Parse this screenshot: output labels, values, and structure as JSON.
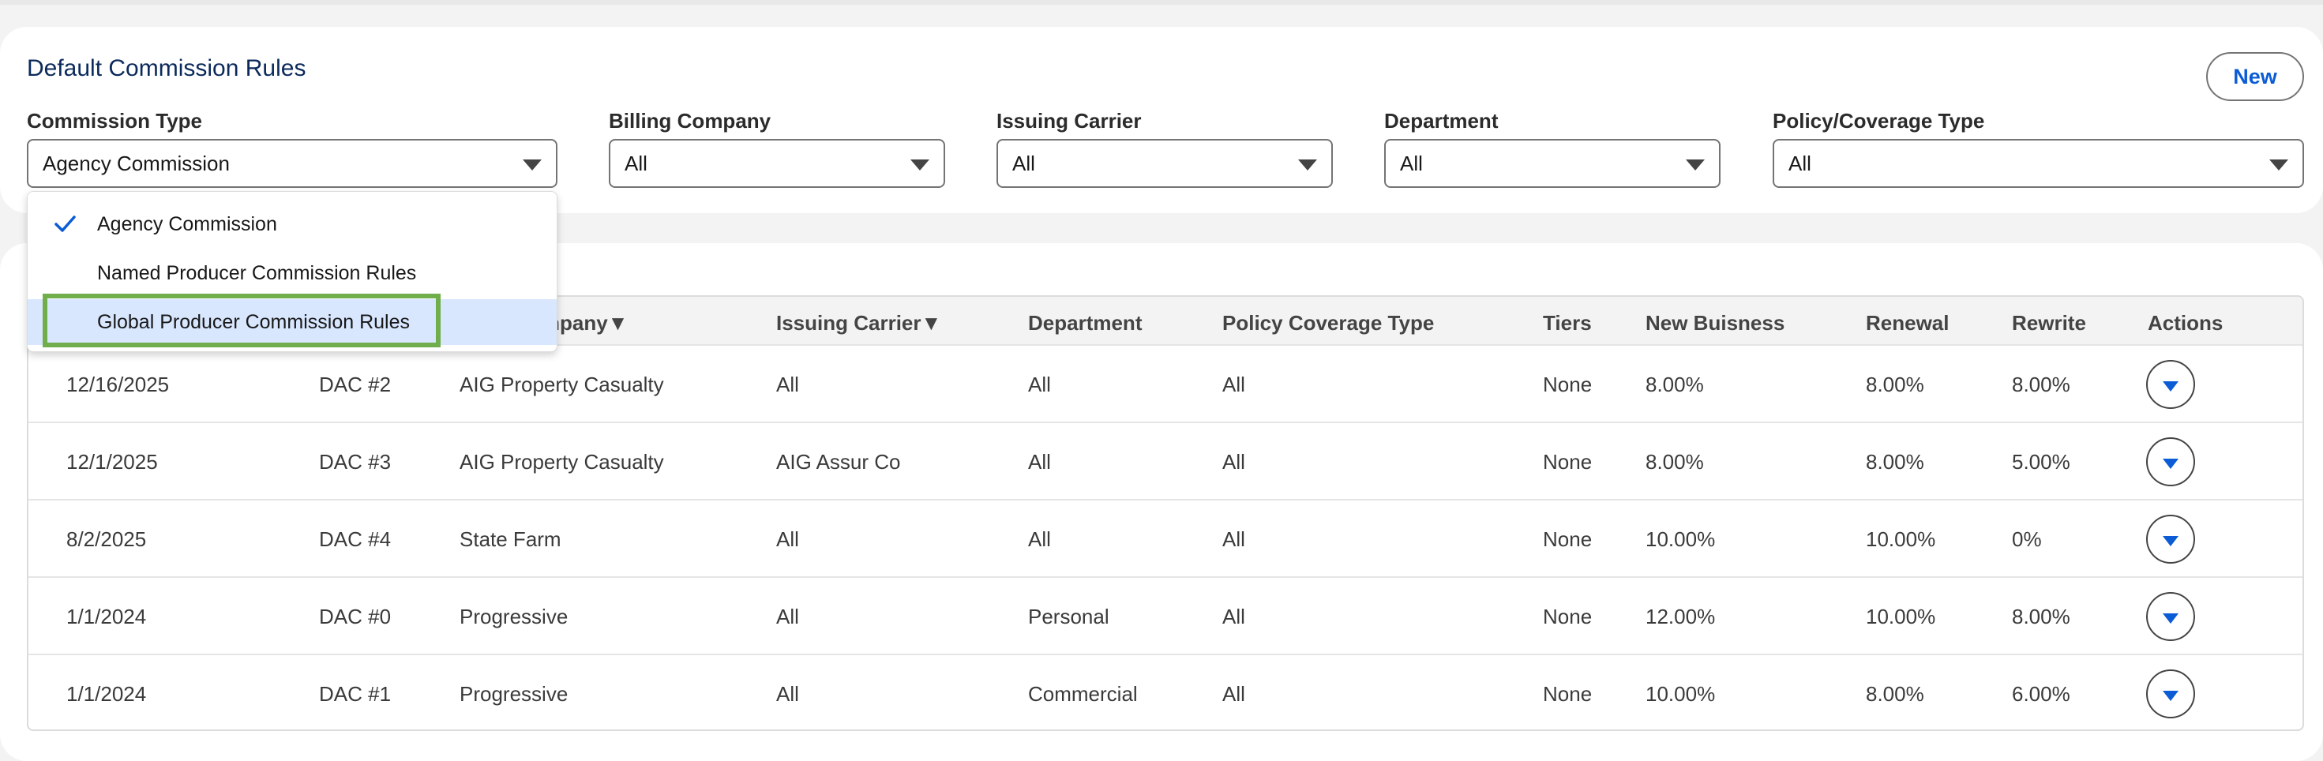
{
  "header": {
    "title": "Default Commission Rules",
    "new_label": "New"
  },
  "filters": {
    "commission_type": {
      "label": "Commission Type",
      "value": "Agency Commission"
    },
    "billing_company": {
      "label": "Billing Company",
      "value": "All"
    },
    "issuing_carrier": {
      "label": "Issuing Carrier",
      "value": "All"
    },
    "department": {
      "label": "Department",
      "value": "All"
    },
    "policy_coverage_type": {
      "label": "Policy/Coverage Type",
      "value": "All"
    }
  },
  "dropdown": {
    "options": [
      {
        "label": "Agency Commission",
        "selected": true
      },
      {
        "label": "Named Producer Commission Rules",
        "selected": false
      },
      {
        "label": "Global Producer Commission Rules",
        "selected": false,
        "highlighted": true
      }
    ]
  },
  "table": {
    "columns": {
      "billing_company": "ompany▼",
      "issuing_carrier": "Issuing Carrier▼",
      "department": "Department",
      "policy_coverage_type": "Policy Coverage Type",
      "tiers": "Tiers",
      "new_business": "New Buisness",
      "renewal": "Renewal",
      "rewrite": "Rewrite",
      "actions": "Actions"
    },
    "rows": [
      {
        "date": "12/16/2025",
        "name": "DAC #2",
        "billing_company": "AIG Property Casualty",
        "issuing_carrier": "All",
        "department": "All",
        "policy_coverage_type": "All",
        "tiers": "None",
        "new_business": "8.00%",
        "renewal": "8.00%",
        "rewrite": "8.00%"
      },
      {
        "date": "12/1/2025",
        "name": "DAC #3",
        "billing_company": "AIG Property Casualty",
        "issuing_carrier": "AIG Assur Co",
        "department": "All",
        "policy_coverage_type": "All",
        "tiers": "None",
        "new_business": "8.00%",
        "renewal": "8.00%",
        "rewrite": "5.00%"
      },
      {
        "date": "8/2/2025",
        "name": "DAC #4",
        "billing_company": "State Farm",
        "issuing_carrier": "All",
        "department": "All",
        "policy_coverage_type": "All",
        "tiers": "None",
        "new_business": "10.00%",
        "renewal": "10.00%",
        "rewrite": "0%"
      },
      {
        "date": "1/1/2024",
        "name": "DAC #0",
        "billing_company": "Progressive",
        "issuing_carrier": "All",
        "department": "Personal",
        "policy_coverage_type": "All",
        "tiers": "None",
        "new_business": "12.00%",
        "renewal": "10.00%",
        "rewrite": "8.00%"
      },
      {
        "date": "1/1/2024",
        "name": "DAC #1",
        "billing_company": "Progressive",
        "issuing_carrier": "All",
        "department": "Commercial",
        "policy_coverage_type": "All",
        "tiers": "None",
        "new_business": "10.00%",
        "renewal": "8.00%",
        "rewrite": "6.00%"
      }
    ]
  },
  "colors": {
    "accent": "#0b5cd5",
    "highlight_box": "#6fae4b",
    "selected_option_bg": "#d8e6fe"
  }
}
